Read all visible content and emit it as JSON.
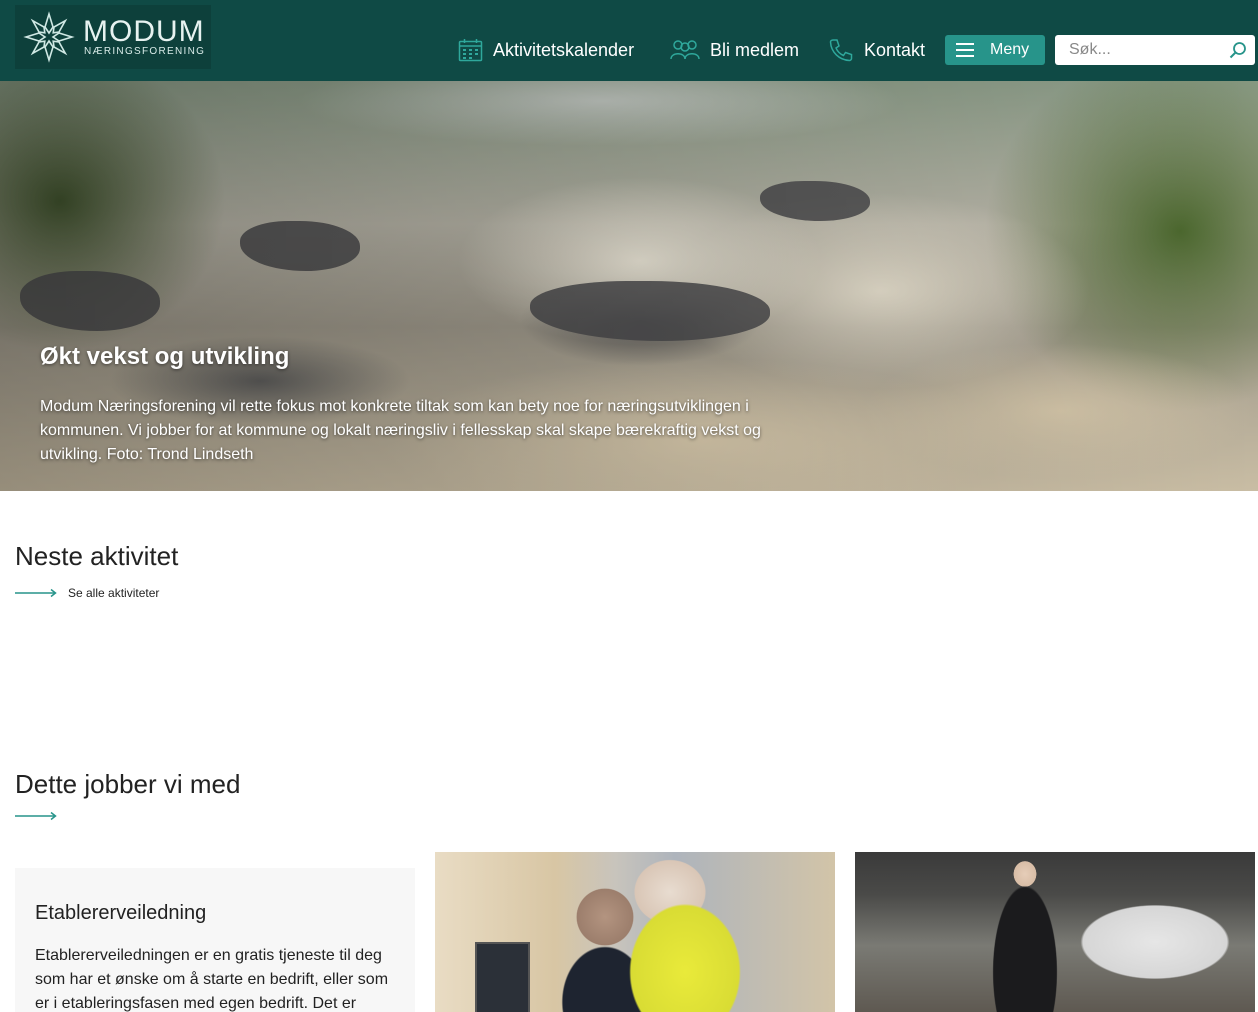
{
  "header": {
    "logo": {
      "title": "MODUM",
      "subtitle": "NÆRINGSFORENING"
    },
    "nav": [
      {
        "label": "Aktivitetskalender",
        "icon": "calendar-icon"
      },
      {
        "label": "Bli medlem",
        "icon": "people-icon"
      },
      {
        "label": "Kontakt",
        "icon": "phone-icon"
      }
    ],
    "menu_label": "Meny",
    "search_placeholder": "Søk..."
  },
  "hero": {
    "title": "Økt vekst og utvikling",
    "text": "Modum Næringsforening vil rette fokus mot konkrete tiltak som kan bety noe for næringsutviklingen i kommunen. Vi jobber for at kommune og lokalt næringsliv i fellesskap skal skape bærekraftig vekst og utvikling. Foto: Trond Lindseth"
  },
  "next_activity": {
    "title": "Neste aktivitet",
    "see_all": "Se alle aktiviteter"
  },
  "work": {
    "title": "Dette jobber vi med",
    "cards": [
      {
        "title": "Etablererveiledning",
        "text": "Etablererveiledningen er en gratis tjeneste til deg som har et ønske om å starte en bedrift, eller som er i etableringsfasen med egen bedrift. Det er"
      }
    ]
  },
  "colors": {
    "header_bg": "#0f4a45",
    "accent": "#27948a",
    "icon_teal": "#2fa89c"
  }
}
